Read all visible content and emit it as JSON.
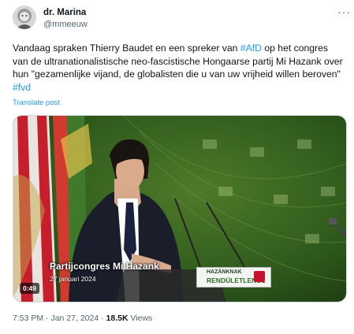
{
  "tweet": {
    "display_name": "dr. Marina",
    "handle": "@mmeeuw",
    "more_icon": "more-horizontal-icon",
    "text_parts": [
      {
        "t": "Vandaag spraken Thierry Baudet en een spreker van ",
        "link": false
      },
      {
        "t": "#AfD",
        "link": true
      },
      {
        "t": " op het congres van de ultranationalistische neo-fascistische Hongaarse partij Mi Hazank over hun \"gezamenlijke vijand, de globalisten die u van uw vrijheid willen beroven\" ",
        "link": false
      },
      {
        "t": "#fvd",
        "link": true
      }
    ],
    "translate_label": "Translate post",
    "video": {
      "duration": "0:49",
      "caption_title": "Partijcongres Mi Hazank",
      "caption_date": "27 januari 2024",
      "podium_line1": "HAZÁNKNAK",
      "podium_line2": "RENDÜLETLENÜL"
    },
    "time": "7:53 PM",
    "date": "Jan 27, 2024",
    "views_count": "18.5K",
    "views_label": "Views",
    "link_color": "#1d9bf0"
  }
}
